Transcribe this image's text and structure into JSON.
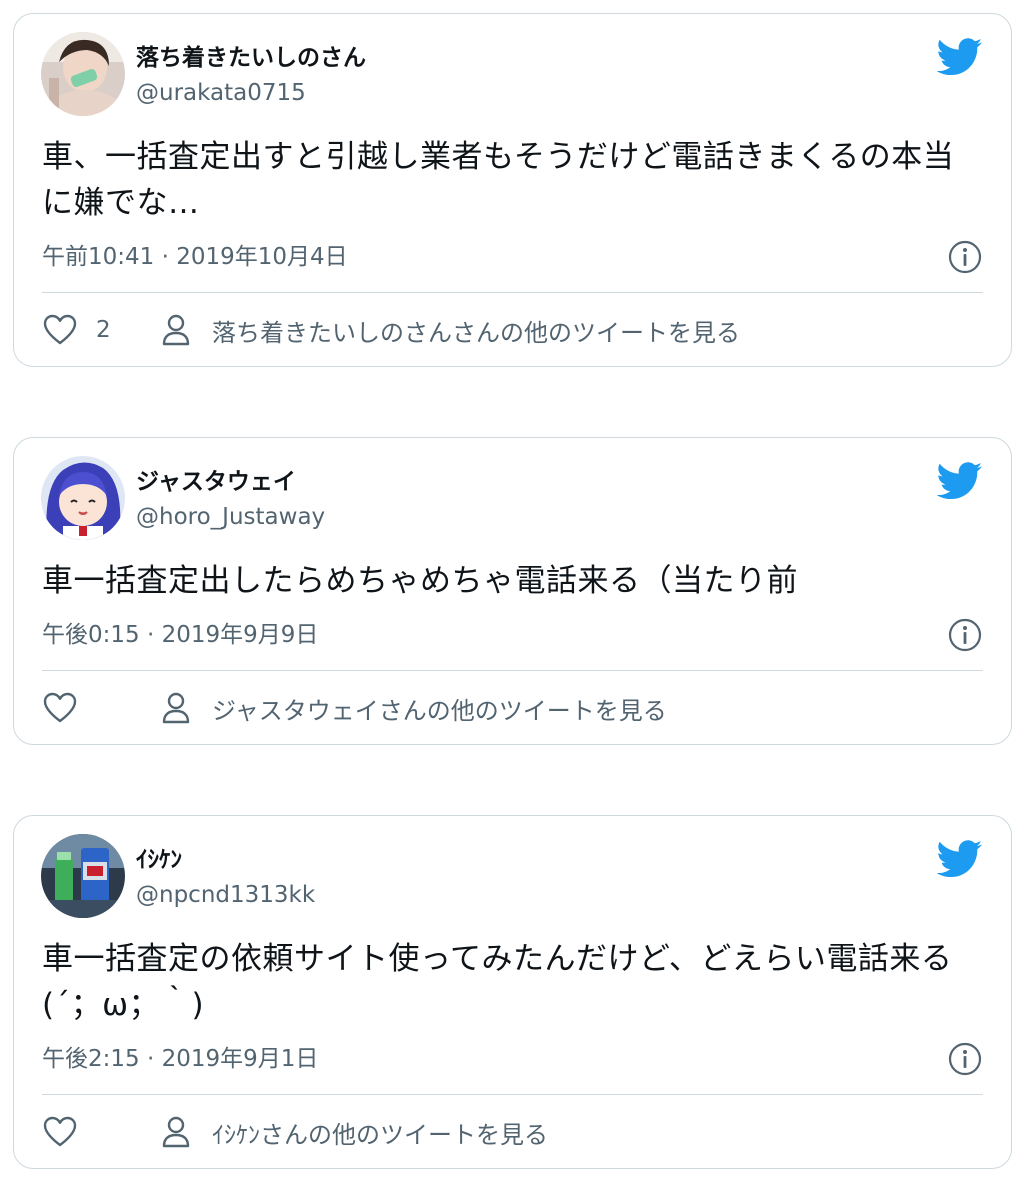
{
  "colors": {
    "twitter_blue": "#1d9bf0",
    "secondary_text": "#536471",
    "border": "#cfd9de"
  },
  "tweets": [
    {
      "display_name": "落ち着きたいしのさん",
      "handle": "@urakata0715",
      "text": "車、一括査定出すと引越し業者もそうだけど電話きまくるの本当に嫌でな…",
      "timestamp": "午前10:41 · 2019年10月4日",
      "like_count": "2",
      "more_tweets_label": "落ち着きたいしのさんさんの他のツイートを見る"
    },
    {
      "display_name": "ジャスタウェイ",
      "handle": "@horo_Justaway",
      "text": "車一括査定出したらめちゃめちゃ電話来る（当たり前",
      "timestamp": "午後0:15 · 2019年9月9日",
      "like_count": "",
      "more_tweets_label": "ジャスタウェイさんの他のツイートを見る"
    },
    {
      "display_name": "ｲｼｹﾝ",
      "handle": "@npcnd1313kk",
      "text": "車一括査定の依頼サイト使ってみたんだけど、どえらい電話来る(´；ω；｀)",
      "timestamp": "午後2:15 · 2019年9月1日",
      "like_count": "",
      "more_tweets_label": "ｲｼｹﾝさんの他のツイートを見る"
    }
  ]
}
